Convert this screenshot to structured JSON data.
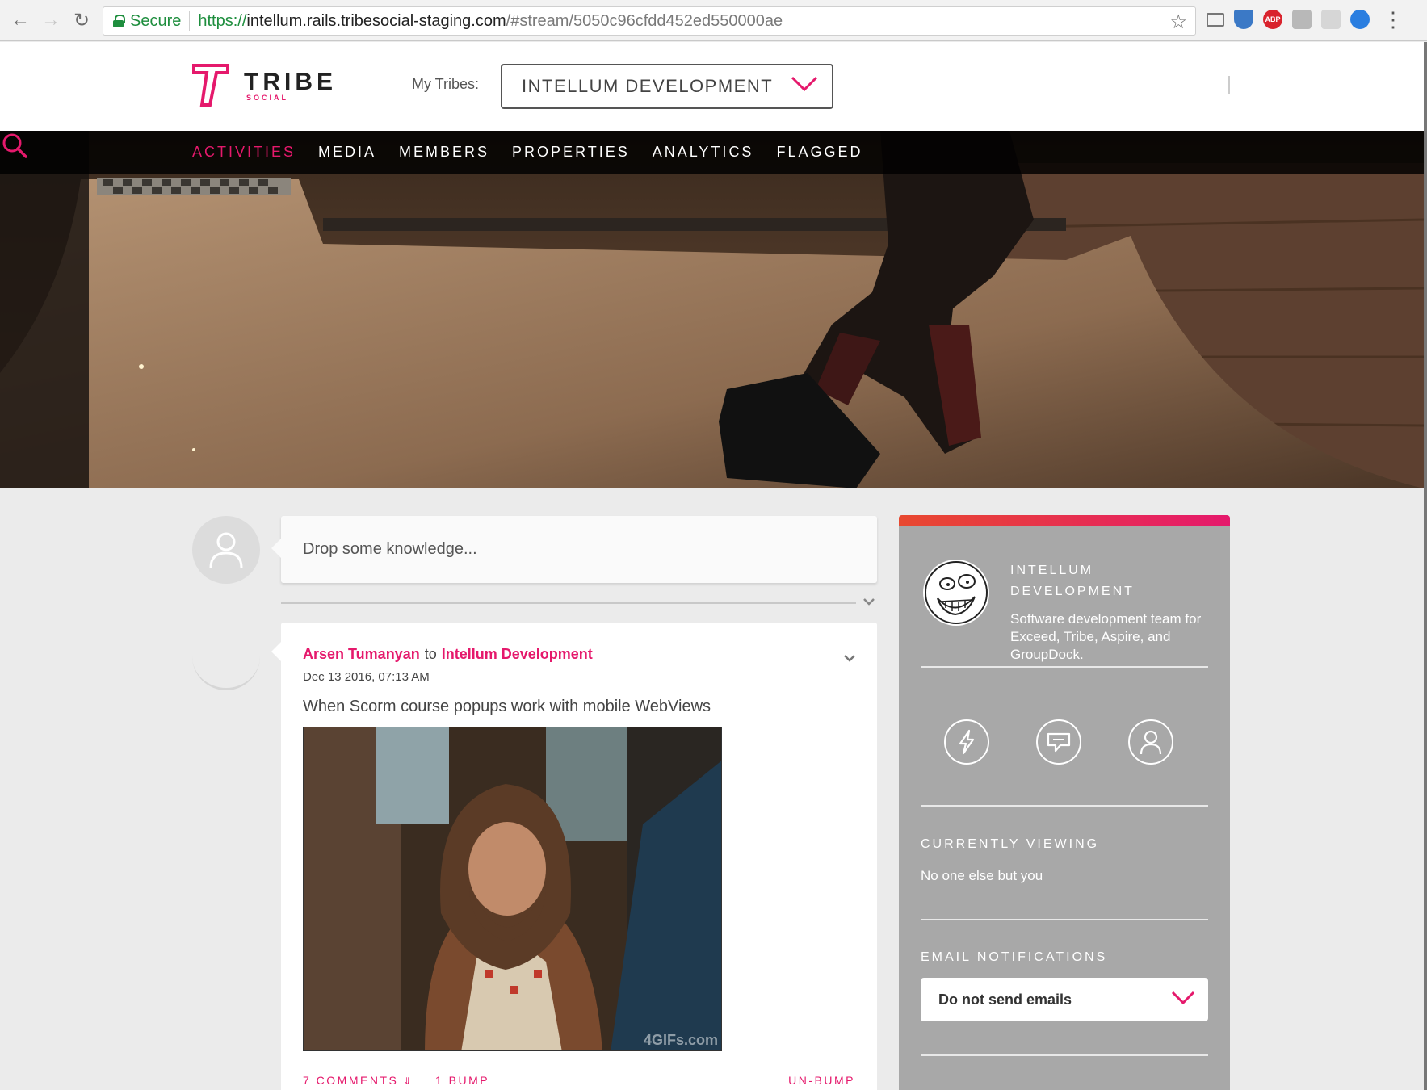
{
  "browser": {
    "secure_label": "Secure",
    "url_scheme": "https://",
    "url_host": "intellum.rails.tribesocial-staging.com",
    "url_path": "/#stream/5050c96cfdd452ed550000ae",
    "extensions": [
      "cast-icon",
      "shield-icon",
      "adblock-icon",
      "folder-icon",
      "tab-icon",
      "extension-icon"
    ],
    "abp_label": "ABP"
  },
  "header": {
    "logo_text": "TRIBE",
    "logo_sub": "SOCIAL",
    "my_tribes_label": "My Tribes:",
    "selected_tribe": "INTELLUM DEVELOPMENT"
  },
  "nav": {
    "items": [
      {
        "label": "ACTIVITIES",
        "active": true
      },
      {
        "label": "MEDIA",
        "active": false
      },
      {
        "label": "MEMBERS",
        "active": false
      },
      {
        "label": "PROPERTIES",
        "active": false
      },
      {
        "label": "ANALYTICS",
        "active": false
      },
      {
        "label": "FLAGGED",
        "active": false
      }
    ]
  },
  "composer": {
    "placeholder": "Drop some knowledge..."
  },
  "post": {
    "author": "Arsen Tumanyan",
    "to_word": "to",
    "target": "Intellum Development",
    "date": "Dec 13 2016, 07:13 AM",
    "text": "When Scorm course popups work with mobile WebViews",
    "image_watermark": "4GIFs.com",
    "comments_label": "7 COMMENTS",
    "bump_label": "1 BUMP",
    "unbump_label": "UN-BUMP"
  },
  "sidebar": {
    "name": "INTELLUM DEVELOPMENT",
    "description": "Software development team for Exceed, Tribe, Aspire, and GroupDock.",
    "currently_viewing_heading": "CURRENTLY VIEWING",
    "currently_viewing_text": "No one else but you",
    "email_heading": "EMAIL NOTIFICATIONS",
    "email_value": "Do not send emails"
  },
  "colors": {
    "accent": "#e5196c",
    "sidebar_bg": "#a8a8a8",
    "secure_green": "#1e8e3e"
  }
}
